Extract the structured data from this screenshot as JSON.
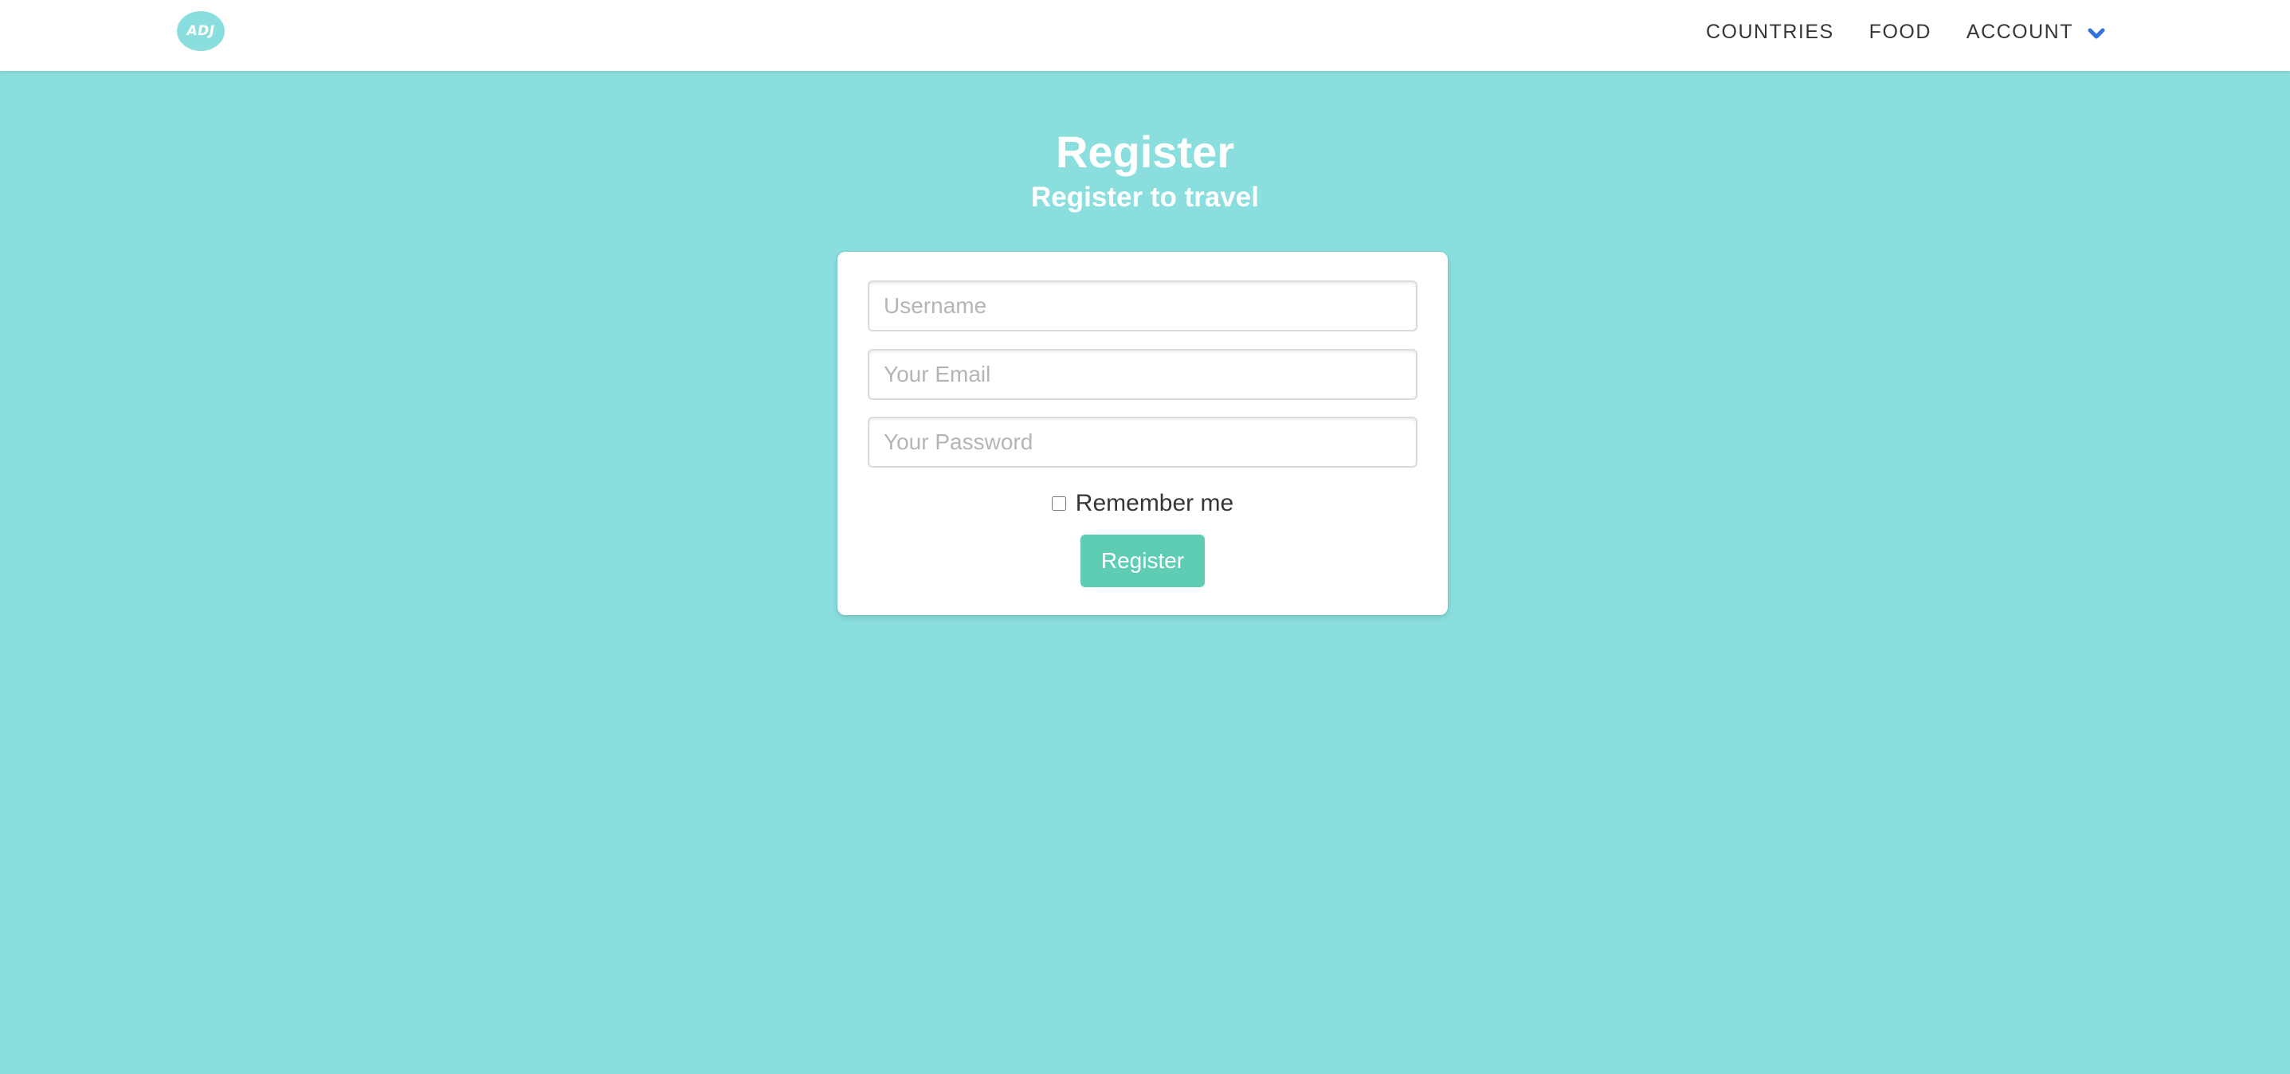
{
  "navbar": {
    "logo_text": "ADJ",
    "items": [
      {
        "label": "COUNTRIES"
      },
      {
        "label": "FOOD"
      },
      {
        "label": "ACCOUNT"
      }
    ],
    "chevron_icon": "chevron-down-icon"
  },
  "hero": {
    "title": "Register",
    "subtitle": "Register to travel"
  },
  "form": {
    "username_placeholder": "Username",
    "email_placeholder": "Your Email",
    "password_placeholder": "Your Password",
    "remember_label": "Remember me",
    "remember_checked": false,
    "submit_label": "Register"
  },
  "colors": {
    "background": "#8adede",
    "button": "#5fcdb4",
    "chevron": "#3273dc"
  }
}
